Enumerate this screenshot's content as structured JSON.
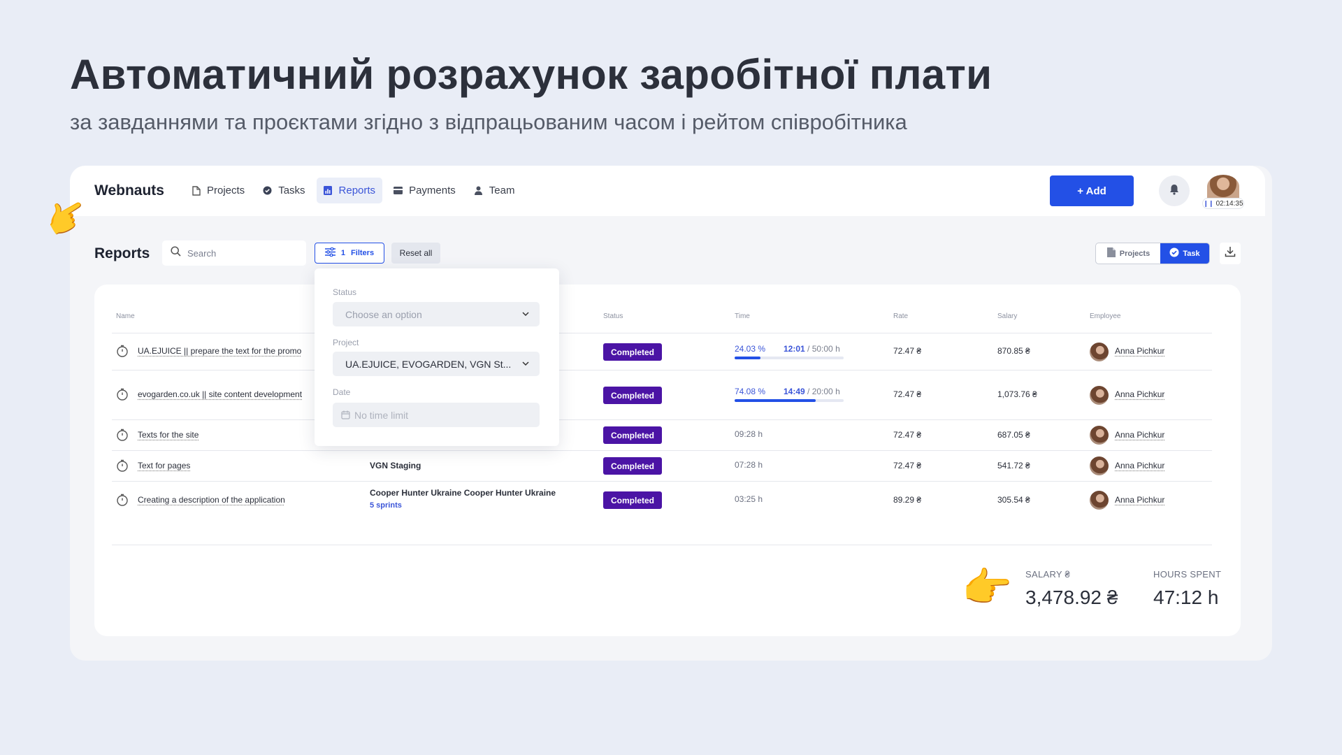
{
  "hero": {
    "title": "Автоматичний розрахунок заробітної плати",
    "subtitle": "за завданнями та проєктами згідно з відпрацьованим часом і рейтом співробітника"
  },
  "app": {
    "brand": "Webnauts",
    "nav": [
      {
        "label": "Projects",
        "icon": "file-icon"
      },
      {
        "label": "Tasks",
        "icon": "check-circle-icon"
      },
      {
        "label": "Reports",
        "icon": "bar-chart-icon",
        "active": true
      },
      {
        "label": "Payments",
        "icon": "card-icon"
      },
      {
        "label": "Team",
        "icon": "person-icon"
      }
    ],
    "add_label": "+ Add",
    "timer": "02:14:35",
    "accent": "#2350e6",
    "badge_color": "#4b14a5"
  },
  "toolbar": {
    "page_title": "Reports",
    "search_placeholder": "Search",
    "filters_count": "1",
    "filters_label": "Filters",
    "reset_label": "Reset all",
    "view_projects": "Projects",
    "view_task": "Task"
  },
  "table": {
    "columns": {
      "name": "Name",
      "status": "Status",
      "time": "Time",
      "rate": "Rate",
      "salary": "Salary",
      "employee": "Employee"
    },
    "rows": [
      {
        "name": "UA.EJUICE || prepare the text for the promo",
        "project": "",
        "project_sub": "",
        "status": "Completed",
        "time_pct": "24.03 %",
        "time_current": "12:01",
        "time_total": " / 50:00 h",
        "progress": 0.2403,
        "time_plain": "",
        "rate": "72.47 ₴",
        "salary": "870.85 ₴",
        "employee": "Anna Pichkur"
      },
      {
        "name": "evogarden.co.uk || site content development",
        "project": "",
        "project_sub": "",
        "status": "Completed",
        "time_pct": "74.08 %",
        "time_current": "14:49",
        "time_total": " / 20:00 h",
        "progress": 0.7408,
        "time_plain": "",
        "rate": "72.47 ₴",
        "salary": "1,073.76 ₴",
        "employee": "Anna Pichkur"
      },
      {
        "name": "Texts for the site",
        "project": "",
        "project_sub": "",
        "status": "Completed",
        "time_plain": "09:28 h",
        "rate": "72.47 ₴",
        "salary": "687.05 ₴",
        "employee": "Anna Pichkur"
      },
      {
        "name": "Text for pages",
        "project": "VGN Staging",
        "project_sub": "",
        "status": "Completed",
        "time_plain": "07:28 h",
        "rate": "72.47 ₴",
        "salary": "541.72 ₴",
        "employee": "Anna Pichkur"
      },
      {
        "name": "Creating a description of the application",
        "project": "Cooper Hunter Ukraine Cooper Hunter Ukraine",
        "project_sub": "5 sprints",
        "status": "Completed",
        "time_plain": "03:25 h",
        "rate": "89.29 ₴",
        "salary": "305.54 ₴",
        "employee": "Anna Pichkur"
      }
    ]
  },
  "filter_dropdown": {
    "status_label": "Status",
    "status_placeholder": "Choose an option",
    "project_label": "Project",
    "project_value": "UA.EJUICE, EVOGARDEN, VGN St...",
    "date_label": "Date",
    "date_placeholder": "No time limit"
  },
  "summary": {
    "salary_label": "SALARY ₴",
    "salary_value": "3,478.92 ₴",
    "hours_label": "HOURS SPENT",
    "hours_value": "47:12 h"
  }
}
